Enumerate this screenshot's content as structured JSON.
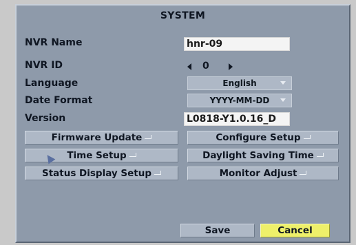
{
  "window": {
    "title": "SYSTEM"
  },
  "fields": {
    "nvr_name_label": "NVR Name",
    "nvr_name_value": "hnr-09",
    "nvr_id_label": "NVR ID",
    "nvr_id_value": "0",
    "language_label": "Language",
    "language_value": "English",
    "date_format_label": "Date Format",
    "date_format_value": "YYYY-MM-DD",
    "version_label": "Version",
    "version_value": "L0818-Y1.0.16_D"
  },
  "buttons": {
    "firmware_update": "Firmware Update",
    "configure_setup": "Configure Setup",
    "time_setup": "Time Setup",
    "daylight_saving_time": "Daylight Saving Time",
    "status_display_setup": "Status Display Setup",
    "monitor_adjust": "Monitor Adjust",
    "save": "Save",
    "cancel": "Cancel"
  },
  "icons": {
    "dropdown": "caret-down-icon",
    "enter": "enter-return-icon",
    "spin_left": "arrow-left-icon",
    "spin_right": "arrow-right-icon",
    "pointer": "mouse-cursor-icon"
  },
  "colors": {
    "panel_bg": "#8e9aaa",
    "button_bg": "#aeb8c6",
    "cancel_highlight": "#eef06a",
    "text": "#0f1622"
  }
}
